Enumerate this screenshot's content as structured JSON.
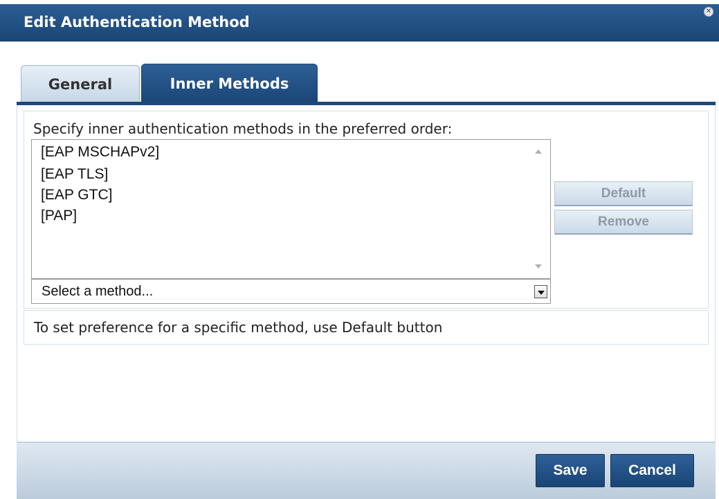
{
  "dialog": {
    "title": "Edit Authentication Method",
    "close_icon": "close-icon"
  },
  "tabs": [
    {
      "label": "General",
      "active": false
    },
    {
      "label": "Inner Methods",
      "active": true
    }
  ],
  "inner_methods": {
    "instruction": "Specify inner authentication methods in the preferred order:",
    "items": [
      "[EAP MSCHAPv2]",
      "[EAP TLS]",
      "[EAP GTC]",
      "[PAP]"
    ],
    "select_value": "Select a method...",
    "default_label": "Default",
    "remove_label": "Remove",
    "hint": "To set preference for a specific method, use Default button"
  },
  "footer": {
    "save_label": "Save",
    "cancel_label": "Cancel"
  },
  "colors": {
    "header_blue": "#1f4f84",
    "button_blue": "#1a4475",
    "disabled_text": "#8e9aa6"
  }
}
